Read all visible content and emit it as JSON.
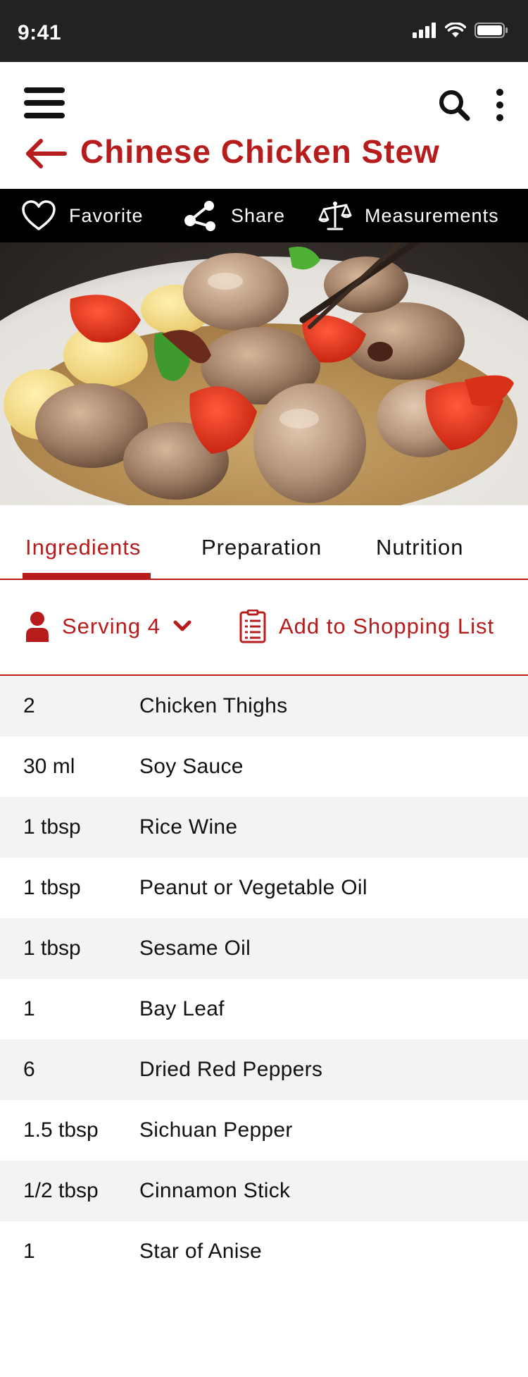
{
  "status_bar": {
    "time": "9:41"
  },
  "header": {
    "title": "Chinese Chicken Stew"
  },
  "actions": [
    {
      "label": "Favorite",
      "icon": "heart-icon"
    },
    {
      "label": "Share",
      "icon": "share-icon"
    },
    {
      "label": "Measurements",
      "icon": "scale-icon"
    }
  ],
  "tabs": [
    {
      "label": "Ingredients",
      "active": true
    },
    {
      "label": "Preparation",
      "active": false
    },
    {
      "label": "Nutrition",
      "active": false
    }
  ],
  "serving": {
    "label": "Serving 4"
  },
  "shopping": {
    "label": "Add to Shopping List"
  },
  "ingredients": [
    {
      "qty": "2",
      "name": "Chicken Thighs"
    },
    {
      "qty": "30 ml",
      "name": "Soy Sauce"
    },
    {
      "qty": "1 tbsp",
      "name": "Rice Wine"
    },
    {
      "qty": "1 tbsp",
      "name": "Peanut or Vegetable Oil"
    },
    {
      "qty": "1 tbsp",
      "name": "Sesame Oil"
    },
    {
      "qty": "1",
      "name": "Bay Leaf"
    },
    {
      "qty": "6",
      "name": "Dried Red Peppers"
    },
    {
      "qty": "1.5 tbsp",
      "name": "Sichuan Pepper"
    },
    {
      "qty": "1/2 tbsp",
      "name": "Cinnamon Stick"
    },
    {
      "qty": "1",
      "name": "Star of Anise"
    }
  ],
  "colors": {
    "accent": "#b71c1c",
    "status_bar": "#222222",
    "action_bar": "#000000",
    "row_alt": "#f3f3f3"
  }
}
